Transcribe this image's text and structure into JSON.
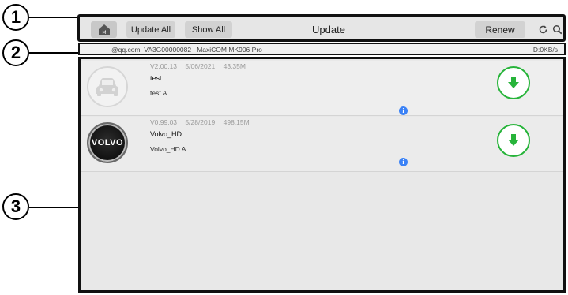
{
  "callouts": [
    "1",
    "2",
    "3"
  ],
  "toolbar": {
    "home_icon": "home-icon",
    "update_all_label": "Update All",
    "show_all_label": "Show All",
    "title": "Update",
    "renew_label": "Renew",
    "refresh_icon": "refresh-icon",
    "search_icon": "search-icon"
  },
  "status_bar": {
    "account": "@qq.com",
    "serial": "VA3G00000082",
    "device": "MaxiCOM MK906 Pro",
    "speed": "D:0KB/s"
  },
  "list": {
    "items": [
      {
        "version": "V2.00.13",
        "date": "5/06/2021",
        "size": "43.35M",
        "name": "test",
        "subtitle": "test  A",
        "logo": "car-placeholder-icon"
      },
      {
        "version": "V0.99.03",
        "date": "5/28/2019",
        "size": "498.15M",
        "name": "Volvo_HD",
        "subtitle": "Volvo_HD  A",
        "logo_text": "VOLVO"
      }
    ]
  },
  "colors": {
    "download_accent": "#27b43a",
    "info_accent": "#3b82f6"
  }
}
